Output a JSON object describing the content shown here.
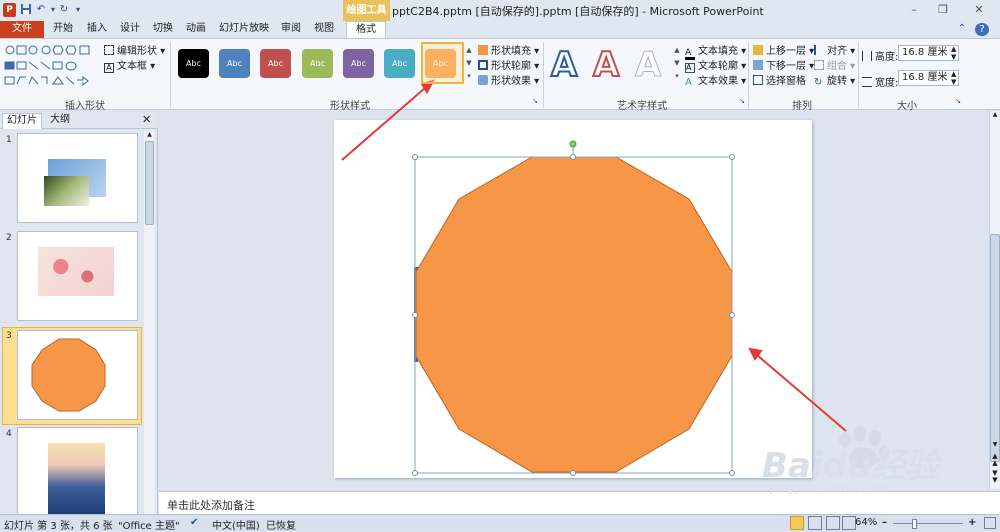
{
  "window": {
    "title": "pptC2B4.pptm [自动保存的].pptm [自动保存的] - Microsoft PowerPoint",
    "context_tab": "绘图工具",
    "logo": "P",
    "qat": [
      "save-icon",
      "undo-icon",
      "redo-icon"
    ],
    "controls": {
      "minimize": "–",
      "restore": "❐",
      "close": "✕"
    },
    "help": "?",
    "ribbon_collapse": "⌃"
  },
  "tabs": {
    "file": "文件",
    "items": [
      "开始",
      "插入",
      "设计",
      "切换",
      "动画",
      "幻灯片放映",
      "审阅",
      "视图"
    ],
    "format": "格式"
  },
  "ribbon": {
    "insert_shapes": {
      "label": "插入形状",
      "edit_shape": "编辑形状",
      "text_box": "文本框"
    },
    "shape_styles": {
      "label": "形状样式",
      "swatch_text": "Abc",
      "swatches": [
        "#000000",
        "#4f81bd",
        "#c0504d",
        "#9bbb59",
        "#8064a2",
        "#4bacc6",
        "#f79646"
      ],
      "selected_index": 6,
      "fill": "形状填充",
      "outline": "形状轮廓",
      "effects": "形状效果"
    },
    "wordart": {
      "label": "艺术字样式",
      "letter": "A",
      "text_fill": "文本填充",
      "text_outline": "文本轮廓",
      "text_effects": "文本效果"
    },
    "arrange": {
      "label": "排列",
      "bring_forward": "上移一层",
      "send_backward": "下移一层",
      "selection_pane": "选择窗格",
      "align": "对齐",
      "group": "组合",
      "rotate": "旋转"
    },
    "size": {
      "label": "大小",
      "height_label": "高度:",
      "height": "16.8 厘米",
      "width_label": "宽度:",
      "width": "16.8 厘米"
    }
  },
  "left_panel": {
    "tab_slides": "幻灯片",
    "tab_outline": "大纲",
    "close": "✕",
    "slide_numbers": [
      "1",
      "2",
      "3",
      "4"
    ],
    "selected_slide": 3
  },
  "slide": {
    "shape": "dodecagon",
    "fill": "#f79646",
    "stroke": "#b8652a"
  },
  "notes": {
    "placeholder": "单击此处添加备注"
  },
  "statusbar": {
    "slide_info": "幻灯片 第 3 张，共 6 张",
    "theme": "\"Office 主题\"",
    "language": "中文(中国)",
    "recovered": "已恢复",
    "zoom": "64%"
  },
  "watermark": {
    "brand": "Baidu经验",
    "url": "jingyan.baidu.com"
  },
  "colors": {
    "accent_orange": "#f79646",
    "file_tab": "#c9401e",
    "context_tab": "#e9c25d",
    "annotation_arrow": "#e53935"
  }
}
